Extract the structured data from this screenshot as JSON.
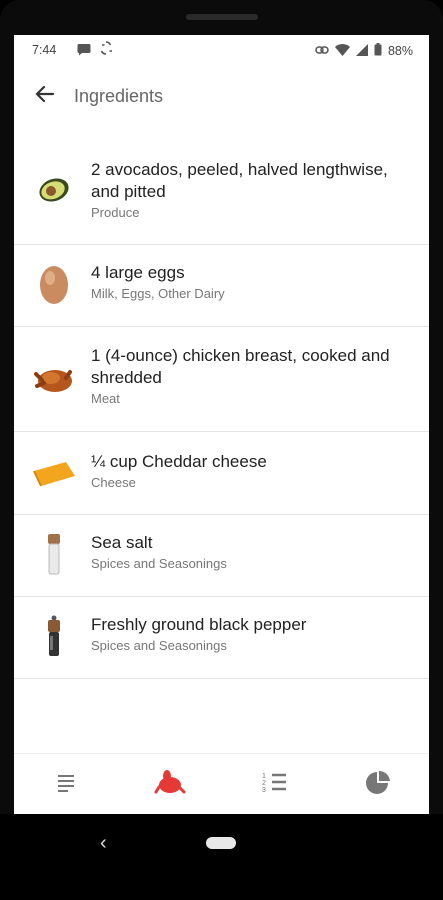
{
  "status": {
    "time": "7:44",
    "battery": "88%"
  },
  "header": {
    "title": "Ingredients"
  },
  "ingredients": [
    {
      "name": "2 avocados, peeled, halved lengthwise, and pitted",
      "category": "Produce",
      "icon": "avocado-icon"
    },
    {
      "name": "4 large eggs",
      "category": "Milk, Eggs, Other Dairy",
      "icon": "egg-icon"
    },
    {
      "name": "1 (4-ounce) chicken breast, cooked and shredded",
      "category": "Meat",
      "icon": "roast-chicken-icon"
    },
    {
      "name": "¼ cup Cheddar cheese",
      "category": "Cheese",
      "icon": "cheese-icon"
    },
    {
      "name": "Sea salt",
      "category": "Spices and Seasonings",
      "icon": "salt-shaker-icon"
    },
    {
      "name": "Freshly ground black pepper",
      "category": "Spices and Seasonings",
      "icon": "pepper-mill-icon"
    }
  ],
  "bottom_nav": [
    {
      "icon": "overview-lines-icon",
      "active": false
    },
    {
      "icon": "ingredients-chicken-icon",
      "active": true
    },
    {
      "icon": "numbered-steps-icon",
      "active": false
    },
    {
      "icon": "nutrition-pie-icon",
      "active": false
    }
  ],
  "colors": {
    "accent": "#e53935",
    "icon_grey": "#777777"
  }
}
